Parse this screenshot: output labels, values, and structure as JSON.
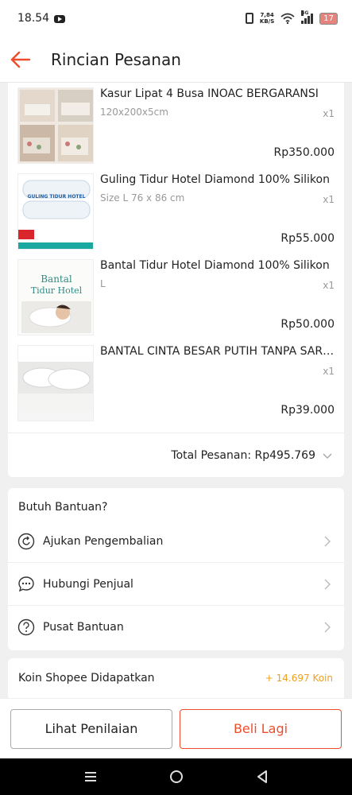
{
  "status_bar": {
    "time": "18.54",
    "net_speed_value": "7,84",
    "net_speed_unit": "KB/S",
    "signal_label": "4G",
    "battery": "17"
  },
  "header": {
    "title": "Rincian Pesanan"
  },
  "products": [
    {
      "name": "Kasur Lipat 4 Busa INOAC BERGARANSI",
      "variant": "120x200x5cm",
      "qty": "x1",
      "price": "Rp350.000"
    },
    {
      "name": "Guling Tidur Hotel Diamond 100% Silikon",
      "variant": "Size L 76 x 86 cm",
      "qty": "x1",
      "price": "Rp55.000"
    },
    {
      "name": "Bantal Tidur Hotel Diamond 100% Silikon",
      "variant": "L",
      "qty": "x1",
      "price": "Rp50.000"
    },
    {
      "name": "BANTAL CINTA BESAR PUTIH TANPA SARUNG",
      "variant": "",
      "qty": "x1",
      "price": "Rp39.000"
    }
  ],
  "thumb_text": {
    "guling_label": "GULING TIDUR HOTEL",
    "bantal_line1": "Bantal",
    "bantal_line2": "Tidur Hotel"
  },
  "total": {
    "label": "Total Pesanan: Rp495.769"
  },
  "help": {
    "title": "Butuh Bantuan?",
    "items": [
      {
        "label": "Ajukan Pengembalian",
        "icon": "return-icon"
      },
      {
        "label": "Hubungi Penjual",
        "icon": "chat-icon"
      },
      {
        "label": "Pusat Bantuan",
        "icon": "help-icon"
      }
    ]
  },
  "coins": {
    "label": "Koin Shopee Didapatkan",
    "value": "+ 14.697 Koin"
  },
  "actions": {
    "secondary": "Lihat Penilaian",
    "primary": "Beli Lagi"
  },
  "colors": {
    "accent": "#ee4d2d",
    "coin": "#f0a020"
  }
}
